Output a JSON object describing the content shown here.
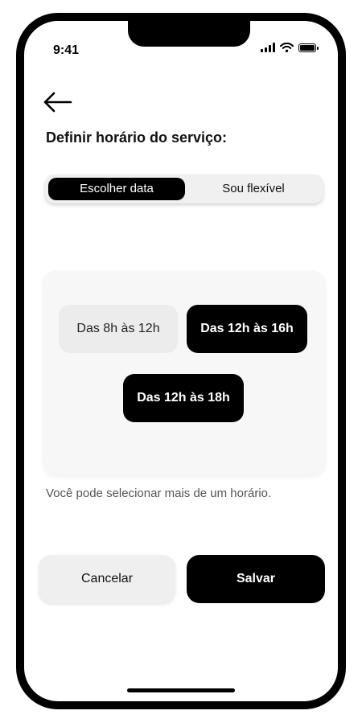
{
  "status_bar": {
    "time": "9:41",
    "icons": [
      "signal-icon",
      "wifi-icon",
      "battery-icon"
    ]
  },
  "header": {
    "back_icon": "arrow-left-icon",
    "title": "Definir horário do serviço:"
  },
  "segmented_control": {
    "options": [
      {
        "label": "Escolher data",
        "selected": true
      },
      {
        "label": "Sou flexível",
        "selected": false
      }
    ]
  },
  "time_slots": [
    {
      "label": "Das 8h às 12h",
      "selected": false
    },
    {
      "label": "Das 12h às 16h",
      "selected": true
    },
    {
      "label": "Das 12h às 18h",
      "selected": true
    }
  ],
  "hint": "Você pode selecionar mais de um horário.",
  "actions": {
    "cancel_label": "Cancelar",
    "save_label": "Salvar"
  },
  "colors": {
    "primary": "#000000",
    "background": "#ffffff",
    "card": "#f7f7f7",
    "unselected": "#ececec"
  }
}
